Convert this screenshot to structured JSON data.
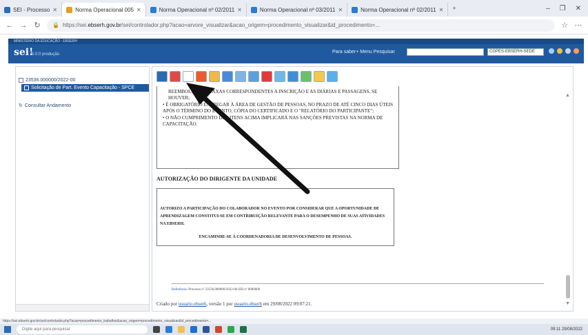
{
  "browser": {
    "tabs": [
      {
        "label": "SEI - Processo",
        "active": false
      },
      {
        "label": "Norma Operacional 005",
        "active": true
      },
      {
        "label": "Norma Operacional nº 02/2011",
        "active": false
      },
      {
        "label": "Norma Operacional nº 03/2011",
        "active": false
      },
      {
        "label": "Norma Operacional nº 02/2011",
        "active": false
      }
    ],
    "url_prefix": "https://sei.",
    "url_domain": "ebserh.gov.br",
    "url_rest": "/sei/controlador.php?acao=arvore_visualizar&acao_origem=procedimento_visualizar&id_procedimento=..."
  },
  "sei": {
    "top_text": "MINISTÉRIO DA EDUCAÇÃO - EBSERH",
    "logo": "sei!",
    "unit": "5.0.0 produção",
    "links": "Para saber+  Menu  Pesquisar",
    "unit_select": "CGPES-EBSERH-SEDE"
  },
  "tree": {
    "items": [
      {
        "label": "23536.000000/2022-00",
        "selected": false
      },
      {
        "label": "Solicitação de Part. Evento Capacitação - SPCE",
        "selected": true
      }
    ],
    "footer_item": "Consultar Andamento"
  },
  "doc": {
    "bullets": [
      "REEMBOLSO DAS TAXAS CORRESPONDENTES A INSCRIÇÃO E AS DIÁRIAS E PASSAGENS, SE HOUVER;",
      "• É OBRIGATÓRIO ENTREGAR À ÁREA DE GESTÃO DE PESSOAS, NO PRAZO DE ATÉ CINCO DIAS ÚTEIS APÓS O TÉRMINO DO EVENTO, CÓPIA DO CERTIFICADO E O \"RELATÓRIO DO PARTICIPANTE\";",
      "• O NÃO CUMPRIMENTO DOS ITENS ACIMA IMPLICARÁ NAS SANÇÕES PREVISTAS NA NORMA DE CAPACITAÇÃO."
    ],
    "section_title": "AUTORIZAÇÃO DO DIRIGENTE DA UNIDADE",
    "auth_text": "AUTORIZO A PARTICIPAÇÃO DO COLABORADOR NO EVENTO POR CONSIDERAR QUE A OPORTUNIDADE DE APRENDIZAGEM CONSTITUI-SE EM CONTRIBUIÇÃO RELEVANTE PARA O DESEMPENHO DE SUAS ATIVIDADES NA EBSERH.",
    "auth_text2": "ENCAMINHE-SE À COORDENADORIA DE DESENVOLVIMENTO DE PESSOAS.",
    "footer_label": "Referência:",
    "footer_text": "Processo nº 23536.000000/2022-00   SEI nº 0000000",
    "sig_created": "Criado por",
    "sig_user1": "usuario.ebserh",
    "sig_version": ", versão 1 por",
    "sig_user2": "usuario.ebserh",
    "sig_date": "em 29/08/2022 09:07:21."
  },
  "statusbar": "https://sei.ebserh.gov.br/sei/controlador.php?acao=procedimento_trabalhar&acao_origem=procedimento_visualizar&id_procedimento=...",
  "taskbar": {
    "search_placeholder": "Digite aqui para pesquisar",
    "clock": "09:11  29/08/2022"
  }
}
